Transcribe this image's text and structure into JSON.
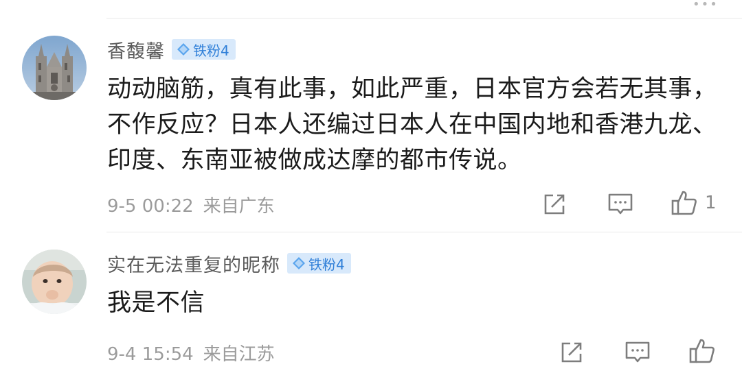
{
  "top": {
    "more_label": "•••"
  },
  "comments": [
    {
      "username": "香馥馨",
      "badge": "铁粉4",
      "text": "动动脑筋，真有此事，如此严重，日本官方会若无其事，不作反应？日本人还编过日本人在中国内地和香港九龙、印度、东南亚被做成达摩的都市传说。",
      "time": "9-5 00:22",
      "location": "来自广东",
      "like_count": "1",
      "avatar_icon": "church-avatar"
    },
    {
      "username": "实在无法重复的昵称",
      "badge": "铁粉4",
      "text": "我是不信",
      "time": "9-4 15:54",
      "location": "来自江苏",
      "like_count": "",
      "avatar_icon": "baby-avatar"
    }
  ],
  "colors": {
    "badge_bg": "#d8e9fb",
    "badge_text": "#2f7fd8",
    "username": "#5b5b5b",
    "meta": "#9b9b9b",
    "icon": "#7d7d7d"
  },
  "icons": [
    "share-icon",
    "comment-icon",
    "like-icon",
    "diamond-icon"
  ]
}
